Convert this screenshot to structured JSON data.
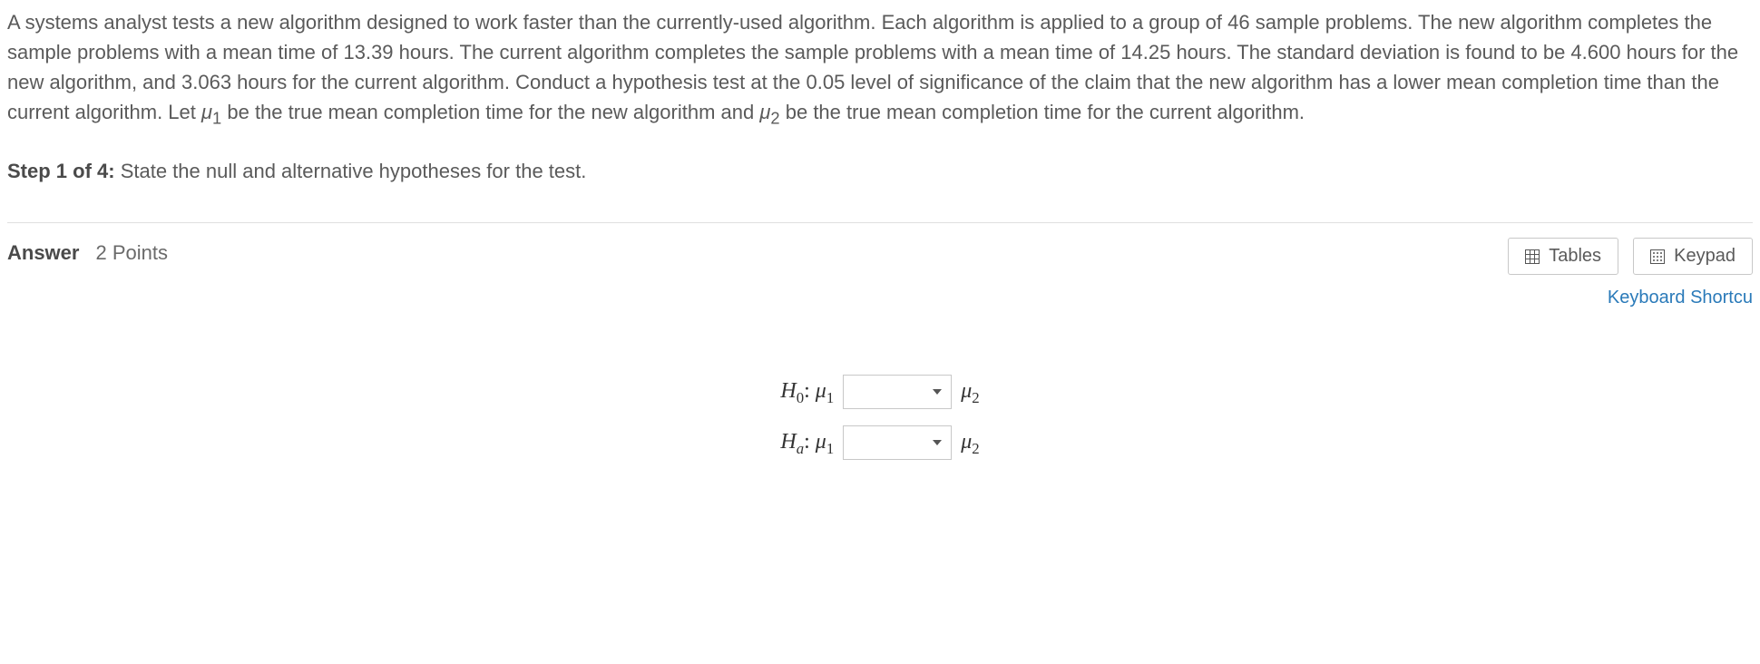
{
  "problem": {
    "text": "A systems analyst tests a new algorithm designed to work faster than the currently-used algorithm. Each algorithm is applied to a group of 46 sample problems. The new algorithm completes the sample problems with a mean time of 13.39 hours. The current algorithm completes the sample problems with a mean time of 14.25 hours. The standard deviation is found to be 4.600 hours for the new algorithm, and 3.063 hours for the current algorithm. Conduct a hypothesis test at the 0.05 level of significance of the claim that the new algorithm has a lower mean completion time than the current algorithm. Let μ1 be the true mean completion time for the new algorithm and μ2 be the true mean completion time for the current algorithm."
  },
  "step": {
    "label": "Step 1 of 4:",
    "instruction": "State the null and alternative hypotheses for the test."
  },
  "answer": {
    "label": "Answer",
    "points": "2 Points"
  },
  "buttons": {
    "tables": "Tables",
    "keypad": "Keypad"
  },
  "links": {
    "keyboard_shortcuts": "Keyboard Shortcu"
  },
  "hypotheses": {
    "h0_prefix": "H",
    "h0_sub": "0",
    "h0_colon": ": ",
    "h0_mu1": "μ",
    "h0_mu1_sub": "1",
    "h0_mu2": "μ",
    "h0_mu2_sub": "2",
    "ha_prefix": "H",
    "ha_sub": "a",
    "ha_colon": ": ",
    "ha_mu1": "μ",
    "ha_mu1_sub": "1",
    "ha_mu2": "μ",
    "ha_mu2_sub": "2",
    "h0_value": "",
    "ha_value": ""
  }
}
